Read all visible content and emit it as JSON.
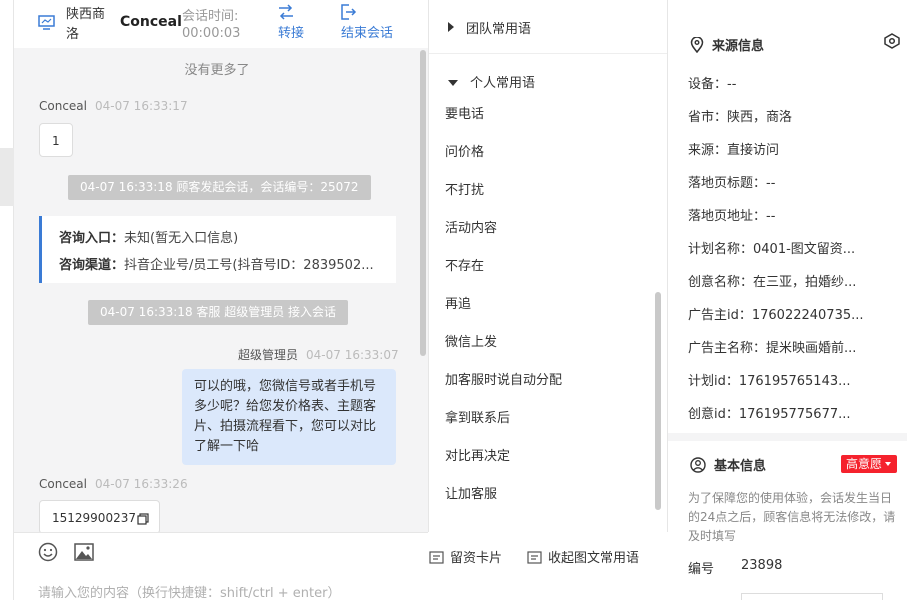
{
  "header": {
    "location": "陕西商洛",
    "customer_name": "Conceal",
    "session_time_label": "会话时间:",
    "session_time": "00:00:03",
    "transfer_label": "转接",
    "end_label": "结束会话"
  },
  "chat": {
    "no_more": "没有更多了",
    "messages": [
      {
        "name": "Conceal",
        "time": "04-07 16:33:17",
        "text": "1"
      },
      {
        "system": "04-07 16:33:18 顾客发起会话，会话编号：25072"
      },
      {
        "system": "04-07 16:33:18 客服 超级管理员 接入会话"
      },
      {
        "name": "超级管理员",
        "time": "04-07 16:33:07",
        "text": "可以的哦，您微信号或者手机号多少呢？给您发价格表、主题客片、拍摄流程看下，您可以对比了解一下哈"
      },
      {
        "name": "Conceal",
        "time": "04-07 16:33:26",
        "text": "15129900237"
      }
    ],
    "info_card": {
      "entry_key": "咨询入口：",
      "entry_value": "未知(暂无入口信息)",
      "channel_key": "咨询渠道：",
      "channel_value": "抖音企业号/员工号(抖音号ID：2839502..."
    }
  },
  "toolbar": {
    "card_label": "留资卡片",
    "collapse_label": "收起图文常用语",
    "input_placeholder": "请输入您的内容（换行快捷键：shift/ctrl + enter）"
  },
  "phrases": {
    "team_group": "团队常用语",
    "personal_group": "个人常用语",
    "items": [
      "要电话",
      "问价格",
      "不打扰",
      "活动内容",
      "不存在",
      "再追",
      "微信上发",
      "加客服时说自动分配",
      "拿到联系后",
      "对比再决定",
      "让加客服"
    ]
  },
  "source_info": {
    "title": "来源信息",
    "fields": [
      "设备：--",
      "省市：陕西，商洛",
      "来源：直接访问",
      "落地页标题：--",
      "落地页地址：--",
      "计划名称：0401-图文留资...",
      "创意名称：在三亚，拍婚纱...",
      "广告主id：176022240735...",
      "广告主名称：提米映画婚前...",
      "计划id：176195765143...",
      "创意id：176195775677..."
    ]
  },
  "basic_info": {
    "title": "基本信息",
    "intent_badge": "高意愿",
    "intent_color": "#f5222d",
    "notice": "为了保障您的使用体验，会话发生当日的24点之后，顾客信息将无法修改，请及时填写",
    "number_label": "编号",
    "number_value": "23898"
  },
  "colors": {
    "accent": "#3a7bd5",
    "agent_bubble": "#dbe8fb",
    "system_pill": "#c8c8c8",
    "chat_bg": "#f4f4f5"
  }
}
